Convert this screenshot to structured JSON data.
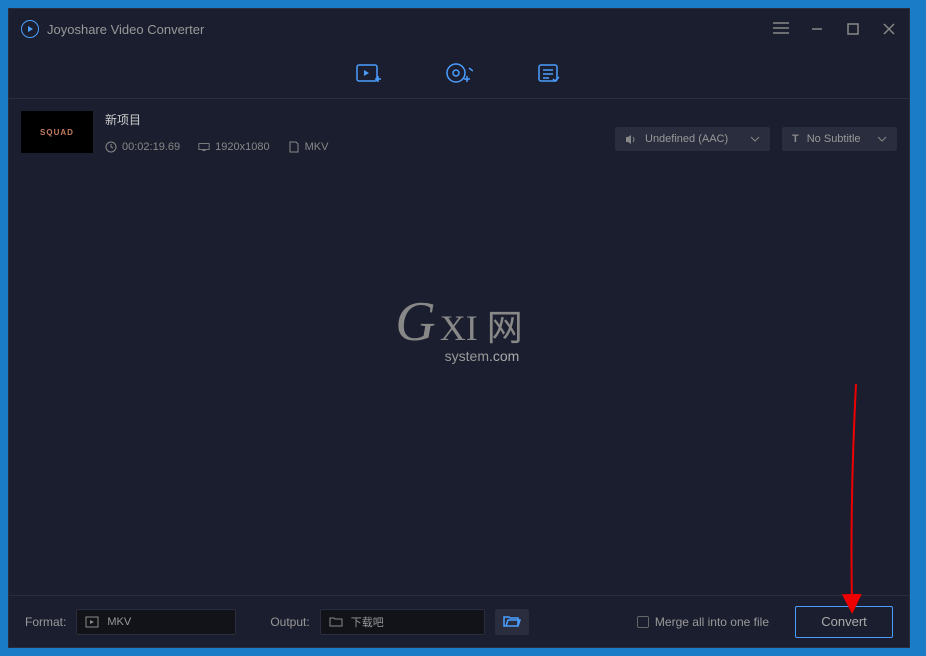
{
  "app": {
    "title": "Joyoshare Video Converter"
  },
  "file": {
    "title": "新项目",
    "duration": "00:02:19.69",
    "resolution": "1920x1080",
    "container": "MKV",
    "audio_track": "Undefined (AAC)",
    "subtitle": "No Subtitle",
    "thumb_text": "SQUAD"
  },
  "watermark": {
    "g": "G",
    "rest": "XI 网",
    "sub1": "system",
    "sub2": ".com"
  },
  "bottom": {
    "format_label": "Format:",
    "format_value": "MKV",
    "output_label": "Output:",
    "output_value": "下载吧",
    "merge_label": "Merge all into one file",
    "convert_label": "Convert"
  }
}
